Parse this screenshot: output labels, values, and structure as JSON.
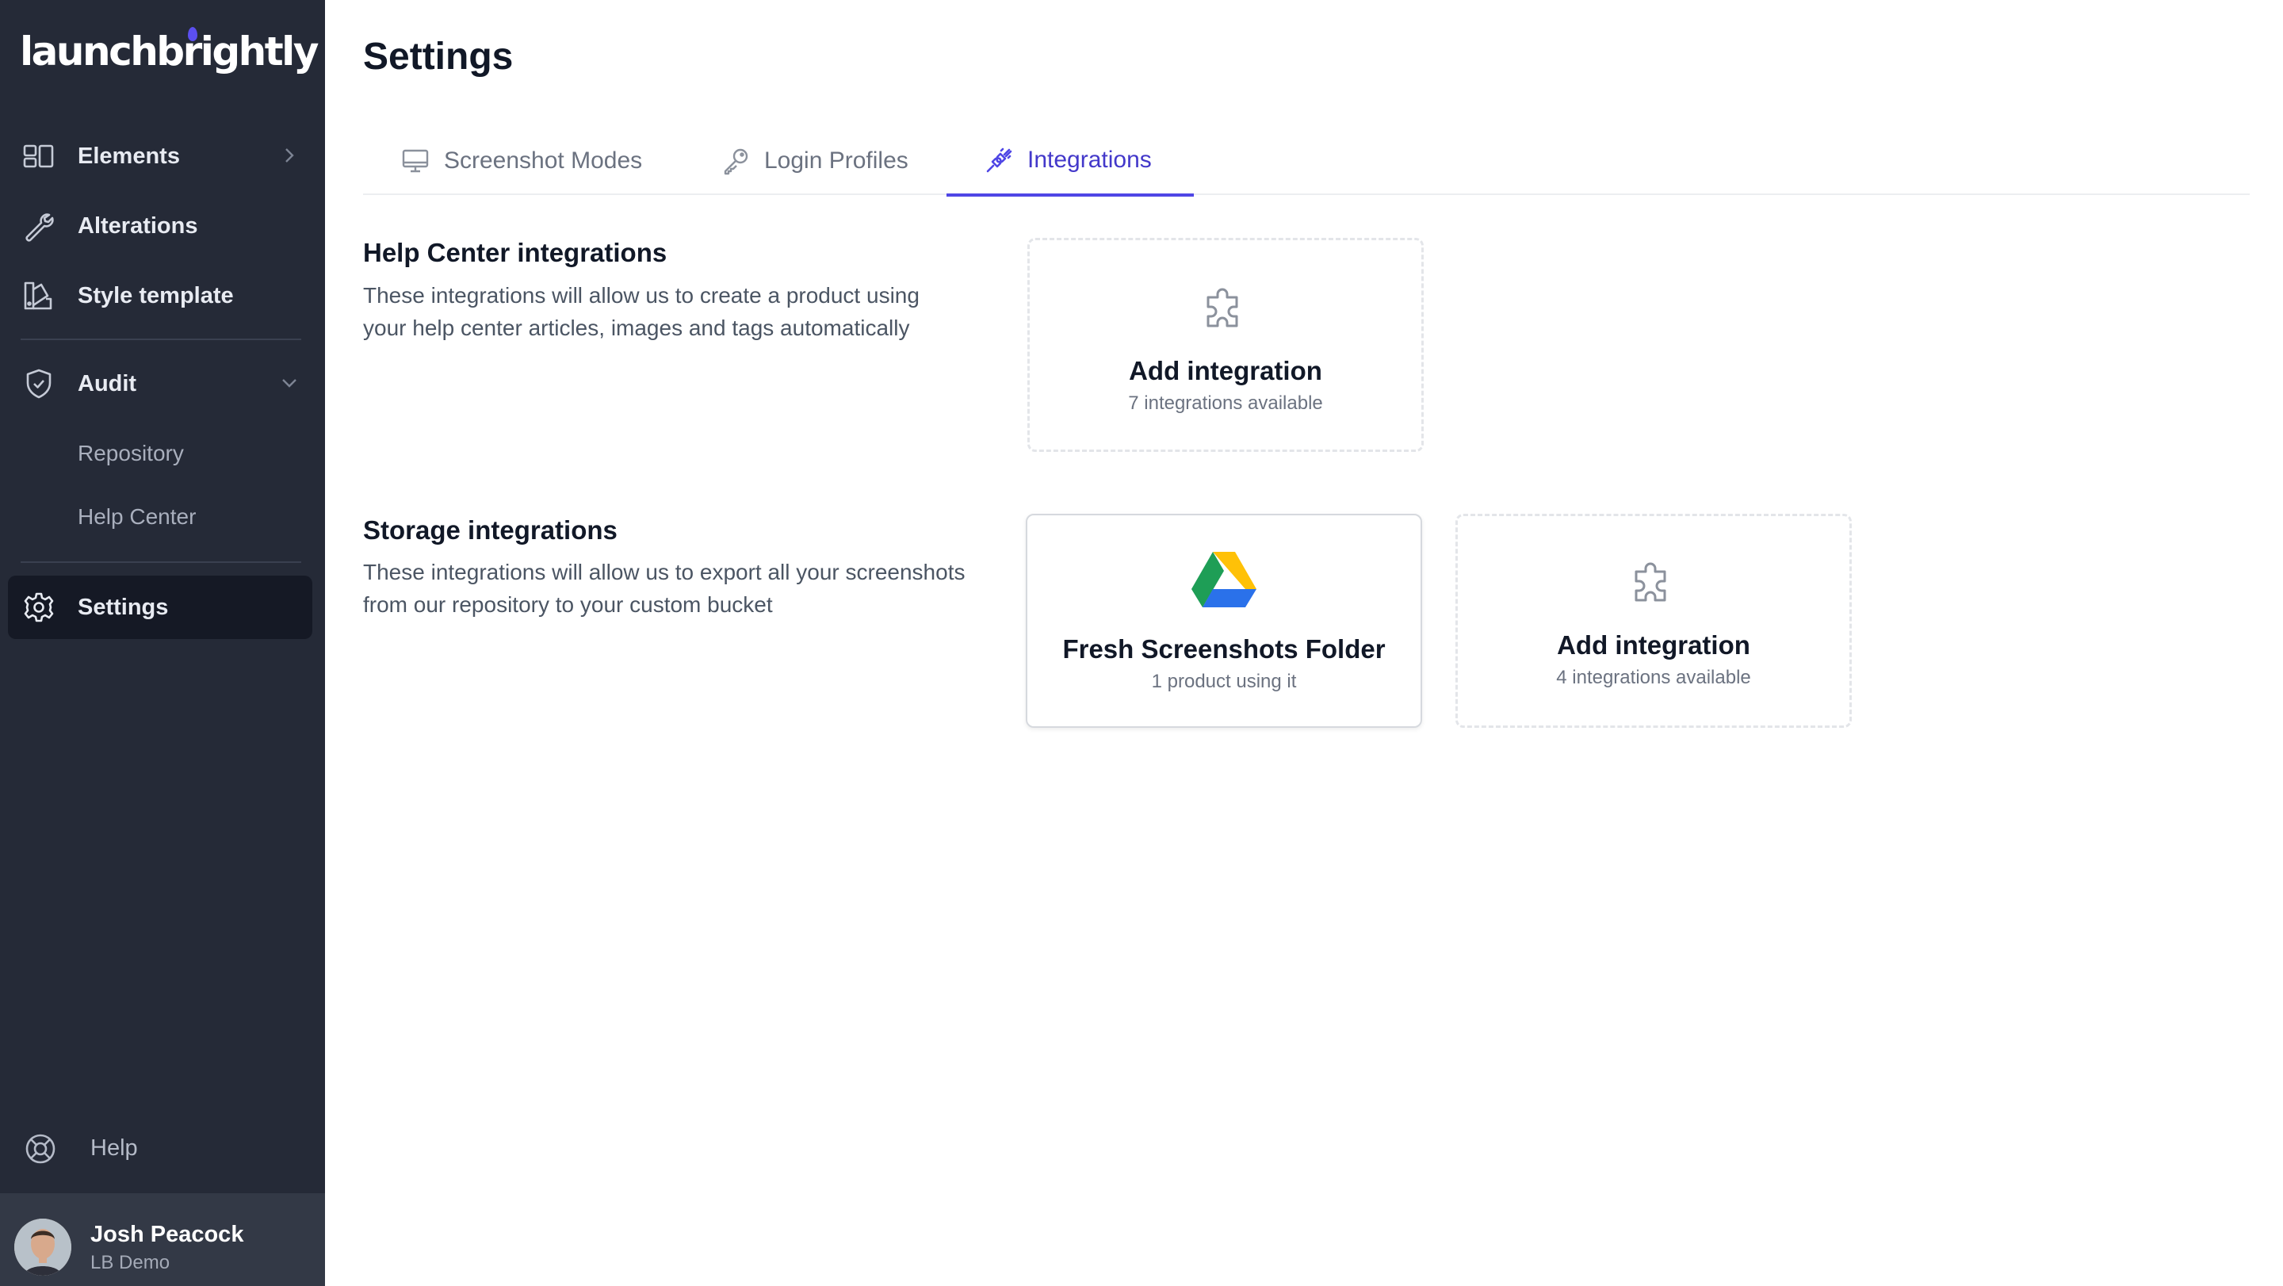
{
  "app": {
    "logo_text": "launchbrightly"
  },
  "sidebar": {
    "items": [
      {
        "label": "Elements",
        "icon": "layout-icon"
      },
      {
        "label": "Alterations",
        "icon": "wrench-icon"
      },
      {
        "label": "Style template",
        "icon": "palette-icon"
      },
      {
        "label": "Audit",
        "icon": "shield-check-icon"
      },
      {
        "label": "Settings",
        "icon": "gear-icon"
      }
    ],
    "audit_children": [
      "Repository",
      "Help Center"
    ],
    "help_label": "Help",
    "user": {
      "name": "Josh Peacock",
      "org": "LB Demo"
    }
  },
  "main": {
    "title": "Settings",
    "tabs": [
      {
        "label": "Screenshot Modes",
        "icon": "monitor-icon",
        "active": false
      },
      {
        "label": "Login Profiles",
        "icon": "key-icon",
        "active": false
      },
      {
        "label": "Integrations",
        "icon": "plug-icon",
        "active": true
      }
    ],
    "sections": [
      {
        "title": "Help Center integrations",
        "description": "These integrations will allow us to create a product using your help center articles, images and tags automatically",
        "cards": [
          {
            "title": "Add integration",
            "subtitle": "7 integrations available",
            "icon": "puzzle-icon"
          }
        ]
      },
      {
        "title": "Storage integrations",
        "description": "These integrations will allow us to export all your screenshots from our repository to your custom bucket",
        "cards": [
          {
            "title": "Fresh Screenshots Folder",
            "subtitle": "1 product using it",
            "icon": "google-drive-icon"
          },
          {
            "title": "Add integration",
            "subtitle": "4 integrations available",
            "icon": "puzzle-icon"
          }
        ]
      }
    ]
  },
  "colors": {
    "sidebar_bg": "#252a37",
    "accent": "#4f46e5",
    "active_tab_text": "#4338ca"
  }
}
